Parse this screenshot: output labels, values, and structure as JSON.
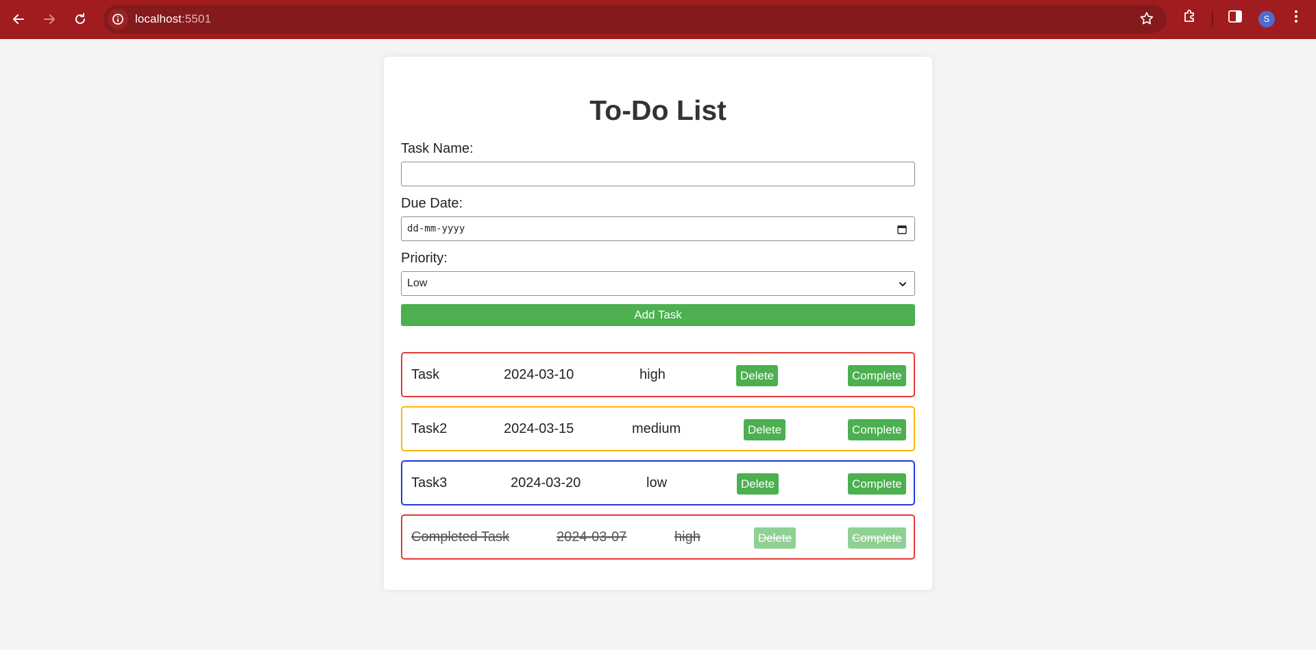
{
  "browser": {
    "url_host": "localhost",
    "url_port": ":5501",
    "avatar_letter": "S"
  },
  "page": {
    "title": "To-Do List",
    "task_name_label": "Task Name:",
    "task_name_value": "",
    "due_date_label": "Due Date:",
    "due_date_placeholder": "dd-mm-yyyy",
    "priority_label": "Priority:",
    "priority_value": "Low",
    "add_button": "Add Task"
  },
  "tasks": [
    {
      "name": "Task",
      "date": "2024-03-10",
      "priority": "high",
      "delete": "Delete",
      "complete": "Complete",
      "border_color": "#e53935",
      "completed": false
    },
    {
      "name": "Task2",
      "date": "2024-03-15",
      "priority": "medium",
      "delete": "Delete",
      "complete": "Complete",
      "border_color": "#ffb300",
      "completed": false
    },
    {
      "name": "Task3",
      "date": "2024-03-20",
      "priority": "low",
      "delete": "Delete",
      "complete": "Complete",
      "border_color": "#1e3ad6",
      "completed": false
    },
    {
      "name": "Completed Task",
      "date": "2024-03-07",
      "priority": "high",
      "delete": "Delete",
      "complete": "Complete",
      "border_color": "#e53935",
      "completed": true
    }
  ],
  "colors": {
    "browser_bar": "#a01c1e",
    "add_button": "#4caf50"
  }
}
